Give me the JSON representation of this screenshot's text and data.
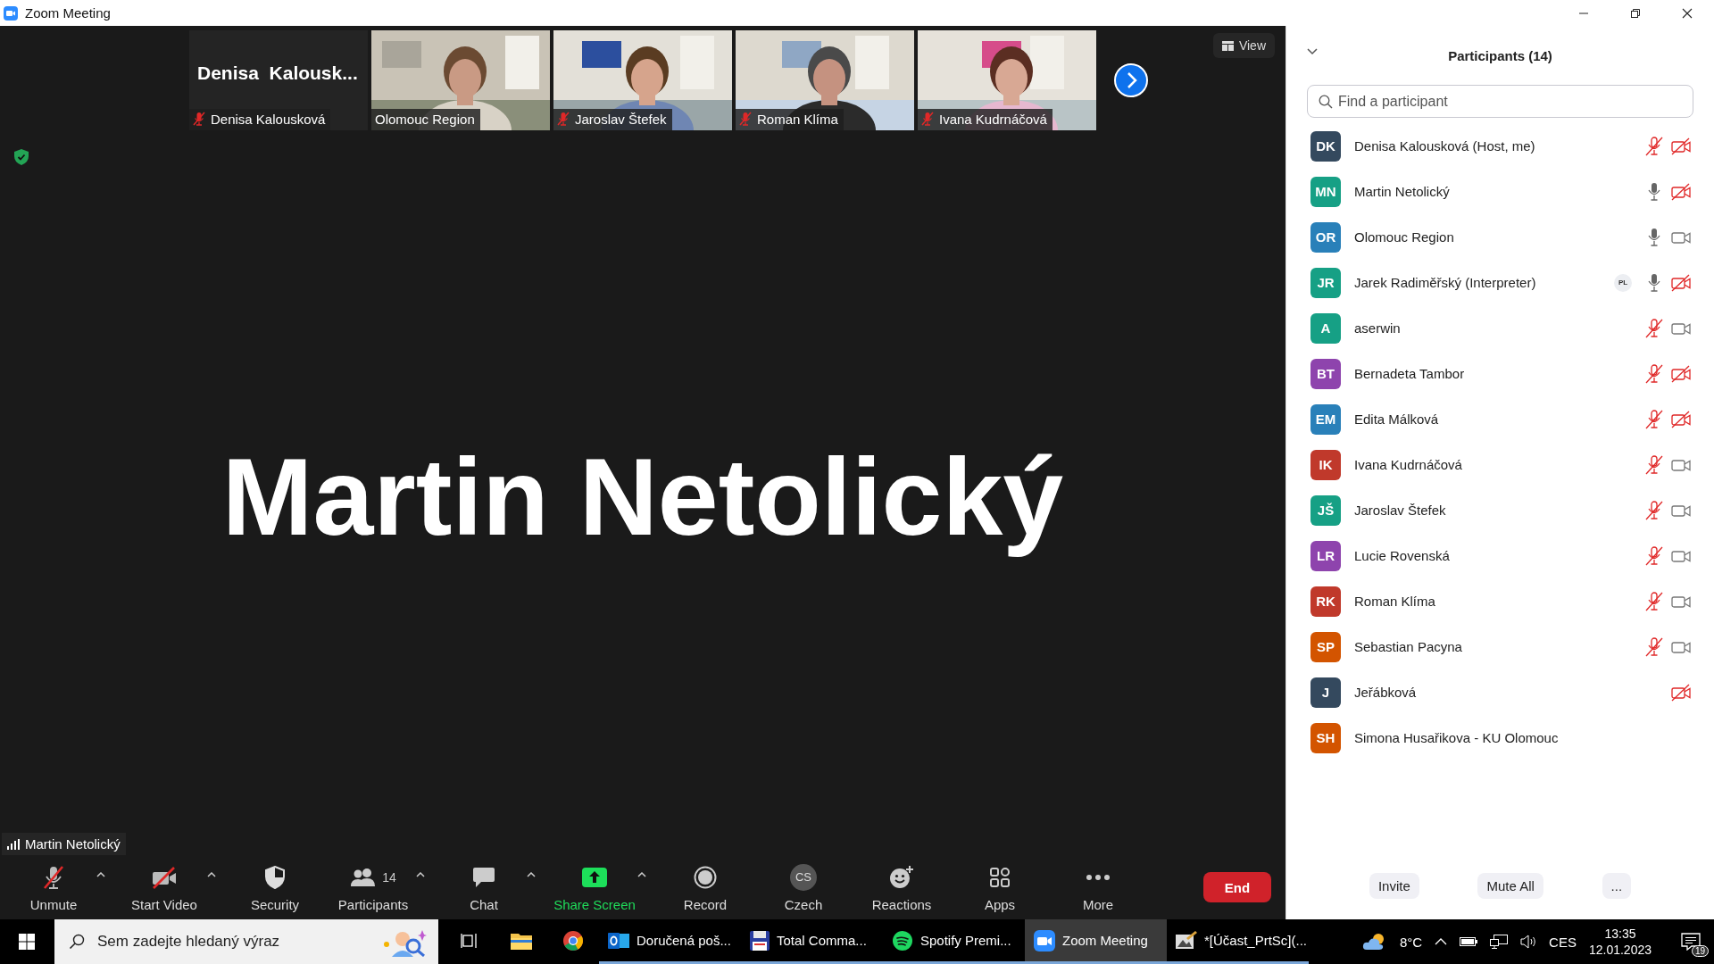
{
  "window": {
    "title": "Zoom Meeting"
  },
  "thumbnails": [
    {
      "kind": "name",
      "display_name": "Denisa  Kalousk...",
      "label": "Denisa Kalousková",
      "muted": true
    },
    {
      "kind": "picture",
      "label": "Olomouc Region",
      "muted": false
    },
    {
      "kind": "picture",
      "label": "Jaroslav Štefek",
      "muted": true
    },
    {
      "kind": "picture",
      "label": "Roman Klíma",
      "muted": true
    },
    {
      "kind": "picture",
      "label": "Ivana Kudrnáčová",
      "muted": true
    }
  ],
  "view_button": {
    "label": "View"
  },
  "speaker": {
    "name": "Martin Netolický",
    "label": "Martin Netolický"
  },
  "toolbar": [
    {
      "label": "Unmute",
      "kind": "mic",
      "slashed": true,
      "caret": true,
      "highlight": false
    },
    {
      "label": "Start Video",
      "kind": "video",
      "slashed": true,
      "caret": true,
      "highlight": false
    },
    {
      "label": "Security",
      "kind": "shield",
      "caret": false,
      "highlight": false
    },
    {
      "label": "Participants",
      "kind": "people",
      "count": "14",
      "caret": true,
      "highlight": false
    },
    {
      "label": "Chat",
      "kind": "chat",
      "caret": true,
      "highlight": false
    },
    {
      "label": "Share Screen",
      "kind": "share",
      "caret": true,
      "highlight": true
    },
    {
      "label": "Record",
      "kind": "record",
      "caret": false,
      "highlight": false
    },
    {
      "label": "Czech",
      "kind": "avatar",
      "avatar_text": "CS",
      "caret": false,
      "highlight": false
    },
    {
      "label": "Reactions",
      "kind": "reactions",
      "caret": false,
      "highlight": false
    },
    {
      "label": "Apps",
      "kind": "apps",
      "caret": false,
      "highlight": false
    },
    {
      "label": "More",
      "kind": "more",
      "caret": false,
      "highlight": false
    }
  ],
  "end_button": {
    "label": "End"
  },
  "panel": {
    "title": "Participants (14)",
    "search": {
      "placeholder": "Find a participant"
    },
    "participants": [
      {
        "initials": "DK",
        "color": "#34495e",
        "name": "Denisa Kalousková (Host, me)",
        "audio": true,
        "muted": true,
        "camera": true,
        "video_off": true
      },
      {
        "initials": "MN",
        "color": "#16a085",
        "name": "Martin Netolický",
        "audio": true,
        "muted": false,
        "camera": true,
        "video_off": true
      },
      {
        "initials": "OR",
        "color": "#2980b9",
        "name": "Olomouc Region",
        "audio": true,
        "muted": false,
        "camera": true,
        "video_off": false
      },
      {
        "initials": "JR",
        "color": "#16a085",
        "name": "Jarek Radiměřský (Interpreter)",
        "badge": "PL",
        "audio": true,
        "muted": false,
        "camera": true,
        "video_off": true
      },
      {
        "initials": "A",
        "color": "#16a085",
        "name": "aserwin",
        "audio": true,
        "muted": true,
        "camera": true,
        "video_off": false
      },
      {
        "initials": "BT",
        "color": "#8e44ad",
        "name": "Bernadeta Tambor",
        "audio": true,
        "muted": true,
        "camera": true,
        "video_off": true
      },
      {
        "initials": "EM",
        "color": "#2980b9",
        "name": "Edita Málková",
        "audio": true,
        "muted": true,
        "camera": true,
        "video_off": true
      },
      {
        "initials": "IK",
        "color": "#c0392b",
        "name": "Ivana Kudrnáčová",
        "audio": true,
        "muted": true,
        "camera": true,
        "video_off": false
      },
      {
        "initials": "JŠ",
        "color": "#16a085",
        "name": "Jaroslav Štefek",
        "audio": true,
        "muted": true,
        "camera": true,
        "video_off": false
      },
      {
        "initials": "LR",
        "color": "#8e44ad",
        "name": "Lucie Rovenská",
        "audio": true,
        "muted": true,
        "camera": true,
        "video_off": false
      },
      {
        "initials": "RK",
        "color": "#c0392b",
        "name": "Roman Klíma",
        "audio": true,
        "muted": true,
        "camera": true,
        "video_off": false
      },
      {
        "initials": "SP",
        "color": "#d35400",
        "name": "Sebastian Pacyna",
        "audio": true,
        "muted": true,
        "camera": true,
        "video_off": false
      },
      {
        "initials": "J",
        "color": "#34495e",
        "name": "Jeřábková",
        "audio": false,
        "camera": true,
        "video_off": true
      },
      {
        "initials": "SH",
        "color": "#d35400",
        "name": "Simona Husařikova - KU Olomouc",
        "audio": false,
        "camera": false
      }
    ],
    "buttons": [
      "Invite",
      "Mute All",
      "..."
    ]
  },
  "taskbar": {
    "search": {
      "placeholder": "Sem zadejte hledaný výraz"
    },
    "apps": [
      {
        "kind": "taskview",
        "active": false
      },
      {
        "kind": "folder",
        "active": false
      },
      {
        "kind": "chrome",
        "active": false
      },
      {
        "kind": "outlook",
        "label": "Doručená poš...",
        "active": false
      },
      {
        "kind": "floppy",
        "label": "Total Comma...",
        "active": false
      },
      {
        "kind": "spotify",
        "label": "Spotify Premi...",
        "active": false
      },
      {
        "kind": "zoom",
        "label": "Zoom Meeting",
        "active": true
      },
      {
        "kind": "paint",
        "label": "*[Účast_PrtSc](...",
        "active": false
      }
    ],
    "temperature": "8°C",
    "language": "CES",
    "time": "13:35",
    "date": "12.01.2023",
    "notifications": "19"
  }
}
